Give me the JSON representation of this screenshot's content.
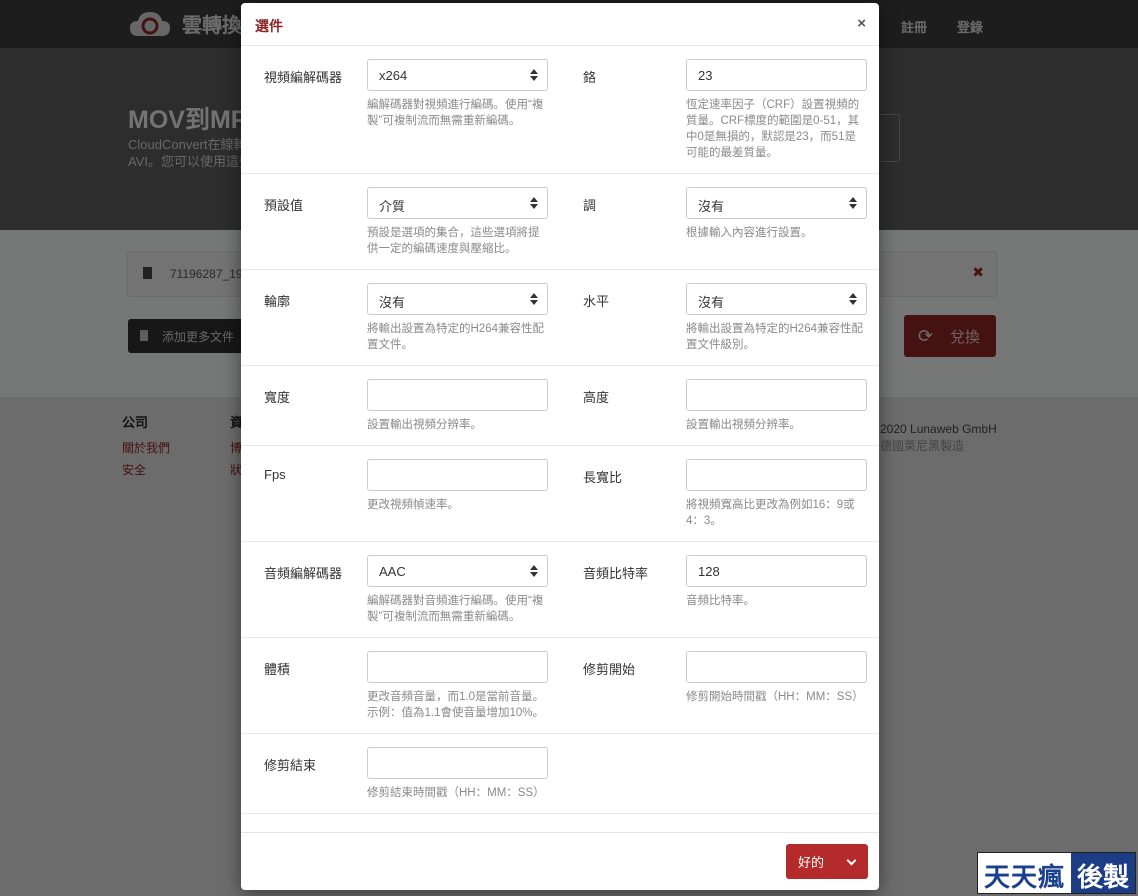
{
  "background": {
    "brand": "雲轉換",
    "nav": [
      "註冊",
      "登錄"
    ],
    "hero_title": "MOV到MP",
    "hero_sub_1": "CloudConvert在線轉",
    "hero_sub_2": "AVI。您可以使用這些",
    "file_name": "71196287_19",
    "add_more_label": "添加更多文件",
    "convert_label": "兌換",
    "footer_col1_title": "公司",
    "footer_col1_links": [
      "關於我們",
      "安全"
    ],
    "footer_col2_title": "資",
    "footer_col2_links": [
      "博",
      "狀"
    ],
    "copyright": "2020 Lunaweb GmbH",
    "location": "德國萊尼黑製造"
  },
  "modal": {
    "title": "選件",
    "close_glyph": "×",
    "ok_label": "好的"
  },
  "options": [
    {
      "left": {
        "label": "視頻編解碼器",
        "type": "select",
        "value": "x264",
        "help": "編解碼器對視頻進行編碼。使用“複製”可複制流而無需重新編碼。"
      },
      "right": {
        "label": "鉻",
        "type": "input",
        "value": "23",
        "help": "恆定速率因子（CRF）設置視頻的質量。CRF標度的範圍是0-51，其中0是無損的，默認是23，而51是可能的最差質量。"
      }
    },
    {
      "left": {
        "label": "預設值",
        "type": "select",
        "value": "介質",
        "help": "預設是選項的集合，這些選項將提供一定的編碼速度與壓縮比。"
      },
      "right": {
        "label": "調",
        "type": "select",
        "value": "沒有",
        "help": "根據輸入內容進行設置。"
      }
    },
    {
      "left": {
        "label": "輪廓",
        "type": "select",
        "value": "沒有",
        "help": "將輸出設置為特定的H264兼容性配置文件。"
      },
      "right": {
        "label": "水平",
        "type": "select",
        "value": "沒有",
        "help": "將輸出設置為特定的H264兼容性配置文件級別。"
      }
    },
    {
      "left": {
        "label": "寬度",
        "type": "input",
        "value": "",
        "help": "設置輸出視頻分辨率。"
      },
      "right": {
        "label": "高度",
        "type": "input",
        "value": "",
        "help": "設置輸出視頻分辨率。"
      }
    },
    {
      "left": {
        "label": "Fps",
        "type": "input",
        "value": "",
        "help": "更改視頻幀速率。"
      },
      "right": {
        "label": "長寬比",
        "type": "input",
        "value": "",
        "help": "將視頻寬高比更改為例如16：9或4：3。"
      }
    },
    {
      "left": {
        "label": "音頻編解碼器",
        "type": "select",
        "value": "AAC",
        "help": "編解碼器對音頻進行編碼。使用“複製”可複制流而無需重新編碼。"
      },
      "right": {
        "label": "音頻比特率",
        "type": "input",
        "value": "128",
        "help": "音頻比特率。"
      }
    },
    {
      "left": {
        "label": "體積",
        "type": "input",
        "value": "",
        "help": "更改音頻音量，而1.0是當前音量。示例：值為1.1會使音量增加10%。"
      },
      "right": {
        "label": "修剪開始",
        "type": "input",
        "value": "",
        "help": "修剪開始時間戳（HH：MM：SS）"
      }
    },
    {
      "left": {
        "label": "修剪結束",
        "type": "input",
        "value": "",
        "help": "修剪結束時間戳（HH：MM：SS）"
      },
      "right": null
    }
  ],
  "watermark": {
    "part1": "天天瘋",
    "part2": "後製"
  }
}
